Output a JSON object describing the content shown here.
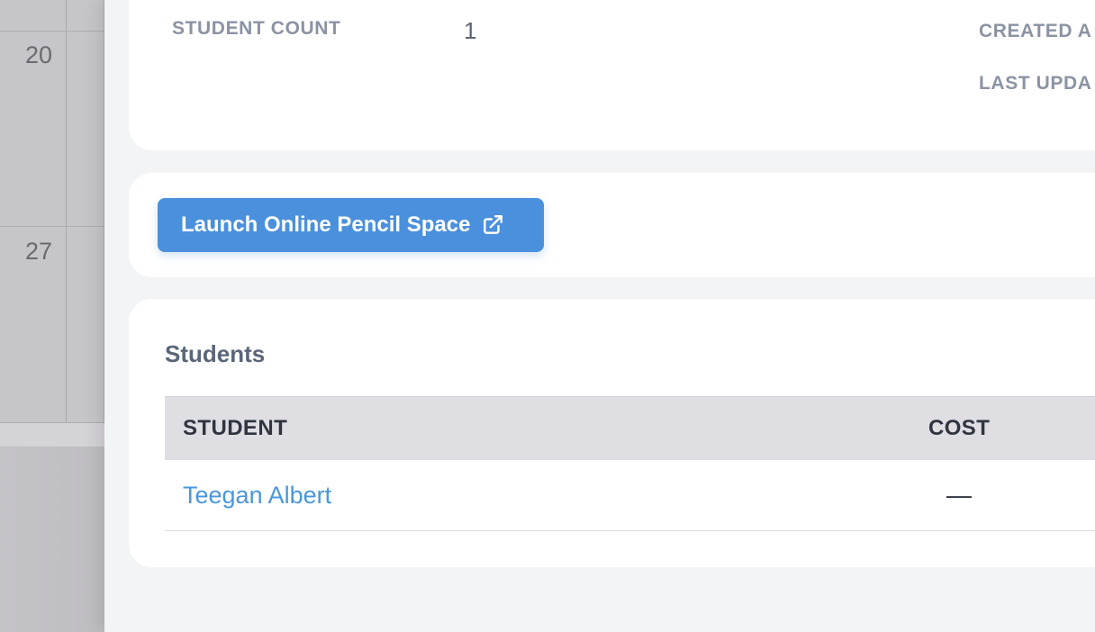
{
  "calendar": {
    "days": [
      "20",
      "27"
    ]
  },
  "info_card": {
    "student_count_label": "STUDENT COUNT",
    "student_count_value": "1",
    "created_label": "CREATED A",
    "updated_label": "LAST UPDA"
  },
  "launch": {
    "button_label": "Launch Online Pencil Space",
    "icon": "external-link-icon"
  },
  "students": {
    "title": "Students",
    "columns": [
      "STUDENT",
      "COST"
    ],
    "rows": [
      {
        "student": "Teegan Albert",
        "cost": "—"
      }
    ]
  },
  "colors": {
    "accent": "#4a90dc",
    "link": "#4a97db",
    "label": "#8b93a3",
    "panel_bg": "#f3f4f6"
  }
}
